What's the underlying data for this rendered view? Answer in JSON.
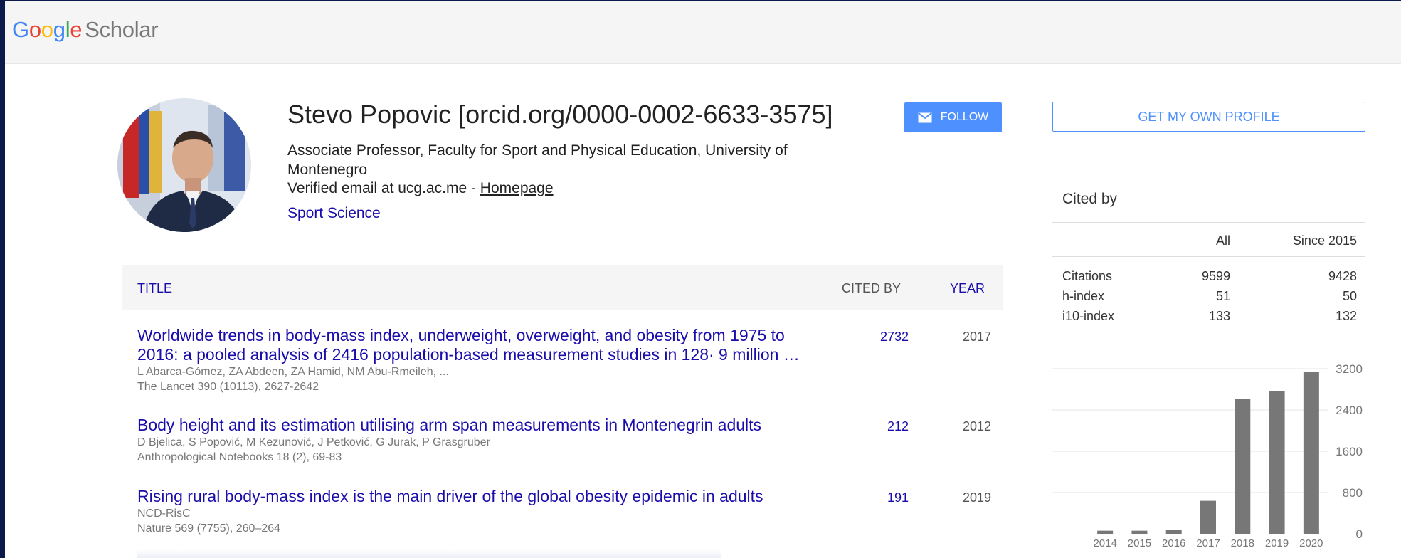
{
  "app": {
    "logo": {
      "google": "Google",
      "scholar": "Scholar"
    }
  },
  "profile": {
    "name": "Stevo Popovic [orcid.org/0000-0002-6633-3575]",
    "affiliation": "Associate Professor, Faculty for Sport and Physical Education, University of Montenegro",
    "email_text": "Verified email at ucg.ac.me - ",
    "homepage_label": "Homepage",
    "interest": "Sport Science",
    "follow_label": "FOLLOW"
  },
  "table": {
    "col_title": "TITLE",
    "col_cited": "CITED BY",
    "col_year": "YEAR",
    "rows": [
      {
        "title": "Worldwide trends in body-mass index, underweight, overweight, and obesity from 1975 to 2016: a pooled analysis of 2416 population-based measurement studies in 128· 9 million …",
        "authors": "L Abarca-Gómez, ZA Abdeen, ZA Hamid, NM Abu-Rmeileh, ...",
        "venue": "The Lancet 390 (10113), 2627-2642",
        "cited": "2732",
        "year": "2017"
      },
      {
        "title": "Body height and its estimation utilising arm span measurements in Montenegrin adults",
        "authors": "D Bjelica, S Popović, M Kezunović, J Petković, G Jurak, P Grasgruber",
        "venue": "Anthropological Notebooks 18 (2), 69-83",
        "cited": "212",
        "year": "2012"
      },
      {
        "title": "Rising rural body-mass index is the main driver of the global obesity epidemic in adults",
        "authors": "NCD-RisC",
        "venue": "Nature 569 (7755), 260–264",
        "cited": "191",
        "year": "2019"
      }
    ]
  },
  "sidebar": {
    "get_profile_label": "GET MY OWN PROFILE",
    "cited_by_heading": "Cited by",
    "col_all": "All",
    "col_since": "Since 2015",
    "stats": [
      {
        "label": "Citations",
        "all": "9599",
        "since": "9428"
      },
      {
        "label": "h-index",
        "all": "51",
        "since": "50"
      },
      {
        "label": "i10-index",
        "all": "133",
        "since": "132"
      }
    ]
  },
  "chart_data": {
    "type": "bar",
    "categories": [
      "2014",
      "2015",
      "2016",
      "2017",
      "2018",
      "2019",
      "2020"
    ],
    "values": [
      60,
      60,
      80,
      640,
      2620,
      2760,
      3140
    ],
    "yticks": [
      "0",
      "800",
      "1600",
      "2400",
      "3200"
    ],
    "ylim": [
      0,
      3200
    ],
    "grid": true,
    "bar_color": "#777777"
  }
}
